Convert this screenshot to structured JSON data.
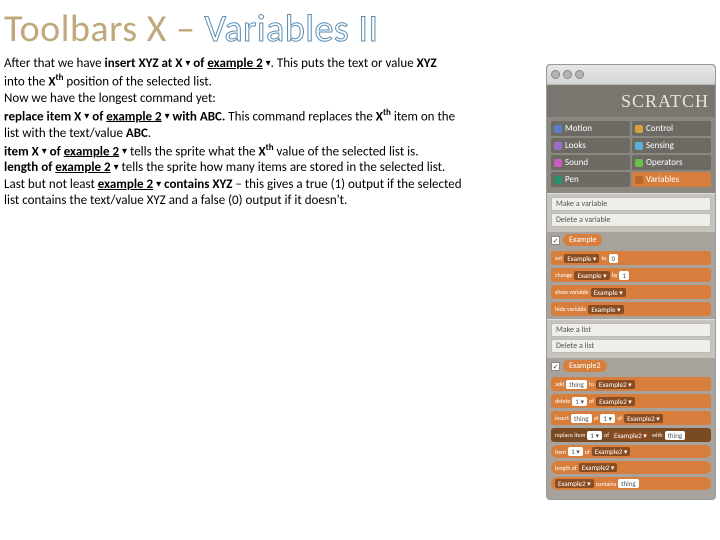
{
  "title_plain": "Toolbars X – ",
  "title_outline": "Variables II",
  "paragraphs": {
    "p1a": "After that we have ",
    "p1b": "insert XYZ at X ",
    "p1c": " of ",
    "p1d": "example 2",
    "p1e": ". This puts the text or value ",
    "p1f": "XYZ",
    "p2a": "into the ",
    "p2b": "X",
    "p2c": "th",
    "p2d": " position of the selected list.",
    "p3": "Now we have the longest command yet:",
    "p4a": "replace item X ",
    "p4b": " of ",
    "p4c": "example 2",
    "p4d": " with ABC.",
    "p4e": " This command replaces the ",
    "p4f": "X",
    "p4g": "th",
    "p4h": " item on the",
    "p5": "list with the text/value ",
    "p5b": "ABC",
    "p5c": ".",
    "p6a": "item X ",
    "p6b": " of ",
    "p6c": "example 2",
    "p6d": " tells the sprite what the ",
    "p6e": "X",
    "p6f": "th",
    "p6g": " value of the selected list is.",
    "p7a": "length of ",
    "p7b": "example 2",
    "p7c": " tells the sprite how many items are stored in the selected list.",
    "p8a": "Last but not least ",
    "p8b": "example 2",
    "p8c": " contains XYZ",
    "p8d": " – this gives a true (1) output if the selected",
    "p9": "list contains the text/value XYZ and a false (0) output if it doesn't."
  },
  "sidebar": {
    "brand": "SCRATCH",
    "cats": [
      {
        "label": "Motion",
        "color": "#5c7ec9"
      },
      {
        "label": "Control",
        "color": "#d6a33a"
      },
      {
        "label": "Looks",
        "color": "#9a6dc9"
      },
      {
        "label": "Sensing",
        "color": "#5bb0d6"
      },
      {
        "label": "Sound",
        "color": "#c65dbf"
      },
      {
        "label": "Operators",
        "color": "#6bbf4b"
      },
      {
        "label": "Pen",
        "color": "#2a8f6f"
      },
      {
        "label": "Variables",
        "color": "#d77e3c"
      }
    ],
    "make_var": "Make a variable",
    "del_var": "Delete a variable",
    "var1": "Example",
    "b_set": "set Example ▾ to 0",
    "b_change": "change Example ▾ by 1",
    "b_show": "show variable Example ▾",
    "b_hide": "hide variable Example ▾",
    "make_list": "Make a list",
    "del_list": "Delete a list",
    "var2": "Example2",
    "b_add": "add thing to Example2 ▾",
    "b_delete": "delete 1 ▾ of Example2 ▾",
    "b_insert": "insert thing at 1 ▾ of Example2 ▾",
    "b_replace": "replace item 1 ▾ of Example2 ▾ with thing",
    "b_item": "item 1 ▾ of Example2 ▾",
    "b_length": "length of Example2 ▾",
    "b_contains": "Example2 ▾ contains thing"
  }
}
